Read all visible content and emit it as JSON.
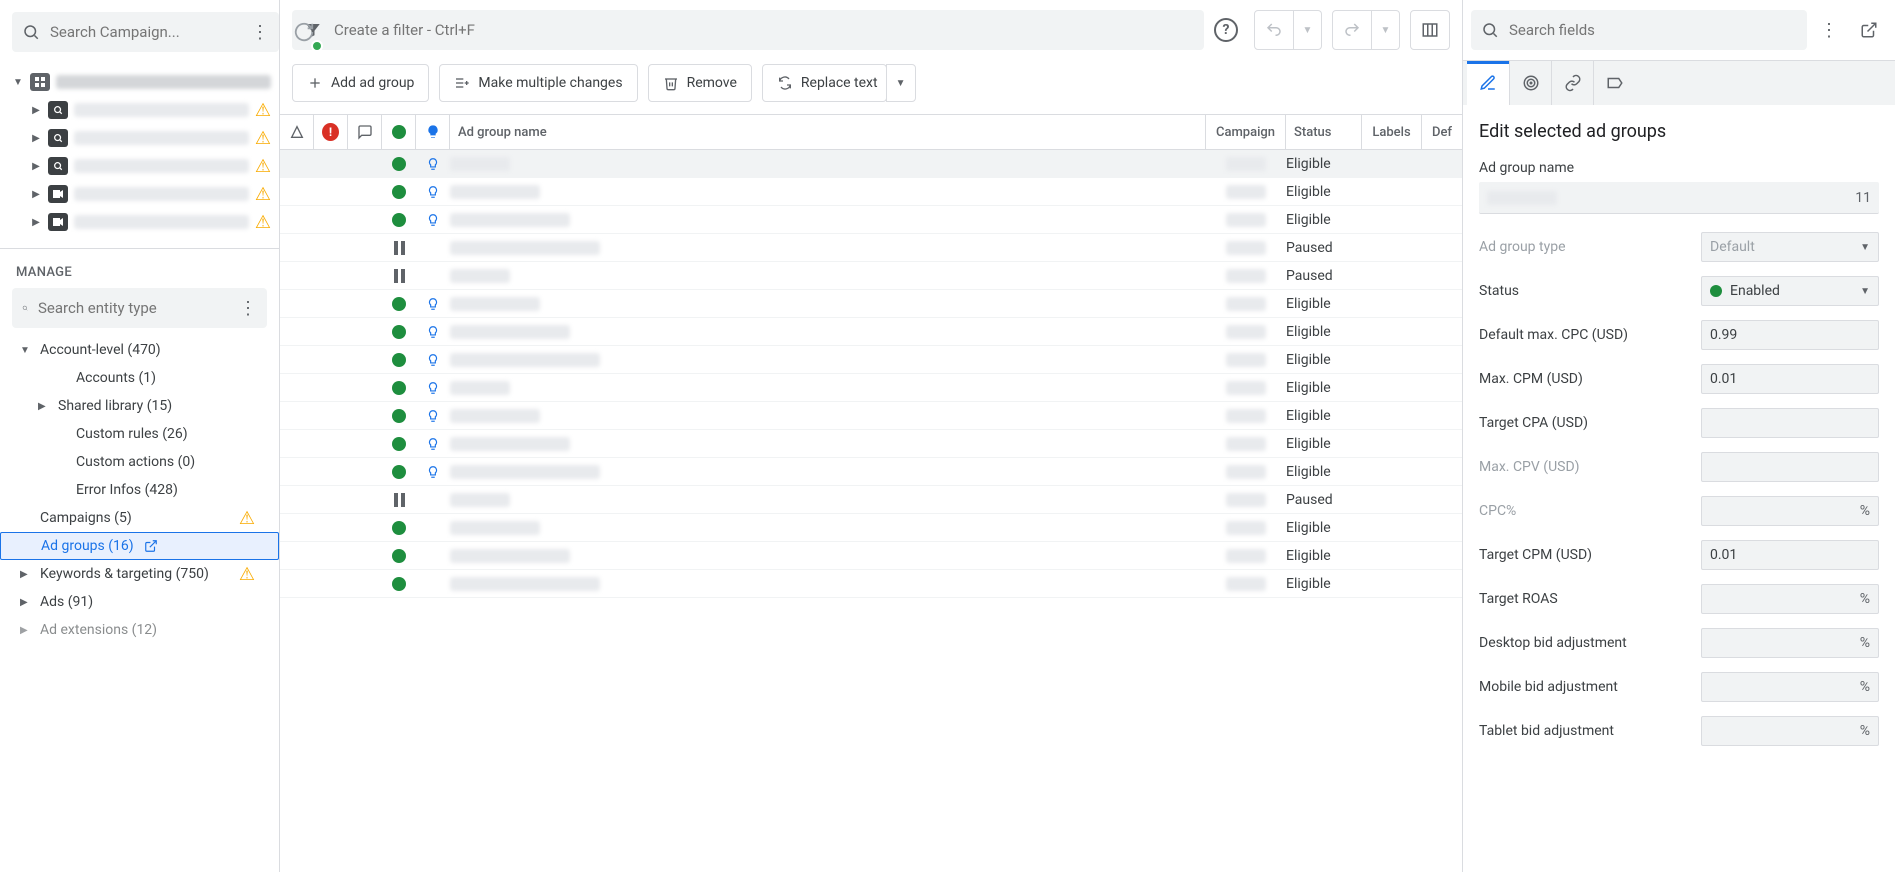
{
  "left": {
    "search_placeholder": "Search Campaign...",
    "manage_title": "MANAGE",
    "entity_search_placeholder": "Search entity type",
    "entities": {
      "account_level": "Account-level (470)",
      "accounts": "Accounts (1)",
      "shared_library": "Shared library (15)",
      "custom_rules": "Custom rules (26)",
      "custom_actions": "Custom actions (0)",
      "error_infos": "Error Infos (428)",
      "campaigns": "Campaigns (5)",
      "ad_groups": "Ad groups (16)",
      "keywords_targeting": "Keywords & targeting (750)",
      "ads": "Ads (91)",
      "ad_extensions": "Ad extensions (12)"
    }
  },
  "mid": {
    "filter_placeholder": "Create a filter - Ctrl+F",
    "buttons": {
      "add": "Add ad group",
      "multi": "Make multiple changes",
      "remove": "Remove",
      "replace": "Replace text"
    },
    "headers": {
      "name": "Ad group name",
      "campaign": "Campaign",
      "status": "Status",
      "labels": "Labels",
      "def": "Def"
    },
    "rows": [
      {
        "state": "enabled",
        "bulb": true,
        "status": "Eligible",
        "selected": true
      },
      {
        "state": "enabled",
        "bulb": true,
        "status": "Eligible"
      },
      {
        "state": "enabled",
        "bulb": true,
        "status": "Eligible"
      },
      {
        "state": "paused",
        "bulb": false,
        "status": "Paused"
      },
      {
        "state": "paused",
        "bulb": false,
        "status": "Paused"
      },
      {
        "state": "enabled",
        "bulb": true,
        "status": "Eligible"
      },
      {
        "state": "enabled",
        "bulb": true,
        "status": "Eligible"
      },
      {
        "state": "enabled",
        "bulb": true,
        "status": "Eligible"
      },
      {
        "state": "enabled",
        "bulb": true,
        "status": "Eligible"
      },
      {
        "state": "enabled",
        "bulb": true,
        "status": "Eligible"
      },
      {
        "state": "enabled",
        "bulb": true,
        "status": "Eligible"
      },
      {
        "state": "enabled",
        "bulb": true,
        "status": "Eligible"
      },
      {
        "state": "paused",
        "bulb": false,
        "status": "Paused"
      },
      {
        "state": "enabled",
        "bulb": false,
        "status": "Eligible"
      },
      {
        "state": "enabled",
        "bulb": false,
        "status": "Eligible"
      },
      {
        "state": "enabled",
        "bulb": false,
        "status": "Eligible"
      }
    ]
  },
  "right": {
    "search_placeholder": "Search fields",
    "title": "Edit selected ad groups",
    "labels": {
      "ad_group_name": "Ad group name",
      "ad_group_type": "Ad group type",
      "status": "Status",
      "default_max_cpc": "Default max. CPC (USD)",
      "max_cpm": "Max. CPM (USD)",
      "target_cpa": "Target CPA (USD)",
      "max_cpv": "Max. CPV (USD)",
      "cpc_pct": "CPC%",
      "target_cpm": "Target CPM (USD)",
      "target_roas": "Target ROAS",
      "desktop_bid": "Desktop bid adjustment",
      "mobile_bid": "Mobile bid adjustment",
      "tablet_bid": "Tablet bid adjustment"
    },
    "values": {
      "name_counter": "11",
      "ad_group_type": "Default",
      "status": "Enabled",
      "default_max_cpc": "0.99",
      "max_cpm": "0.01",
      "target_cpa": "",
      "max_cpv": "",
      "cpc_pct": "",
      "target_cpm": "0.01",
      "target_roas": "",
      "desktop_bid": "",
      "mobile_bid": "",
      "tablet_bid": "",
      "pct": "%"
    }
  }
}
